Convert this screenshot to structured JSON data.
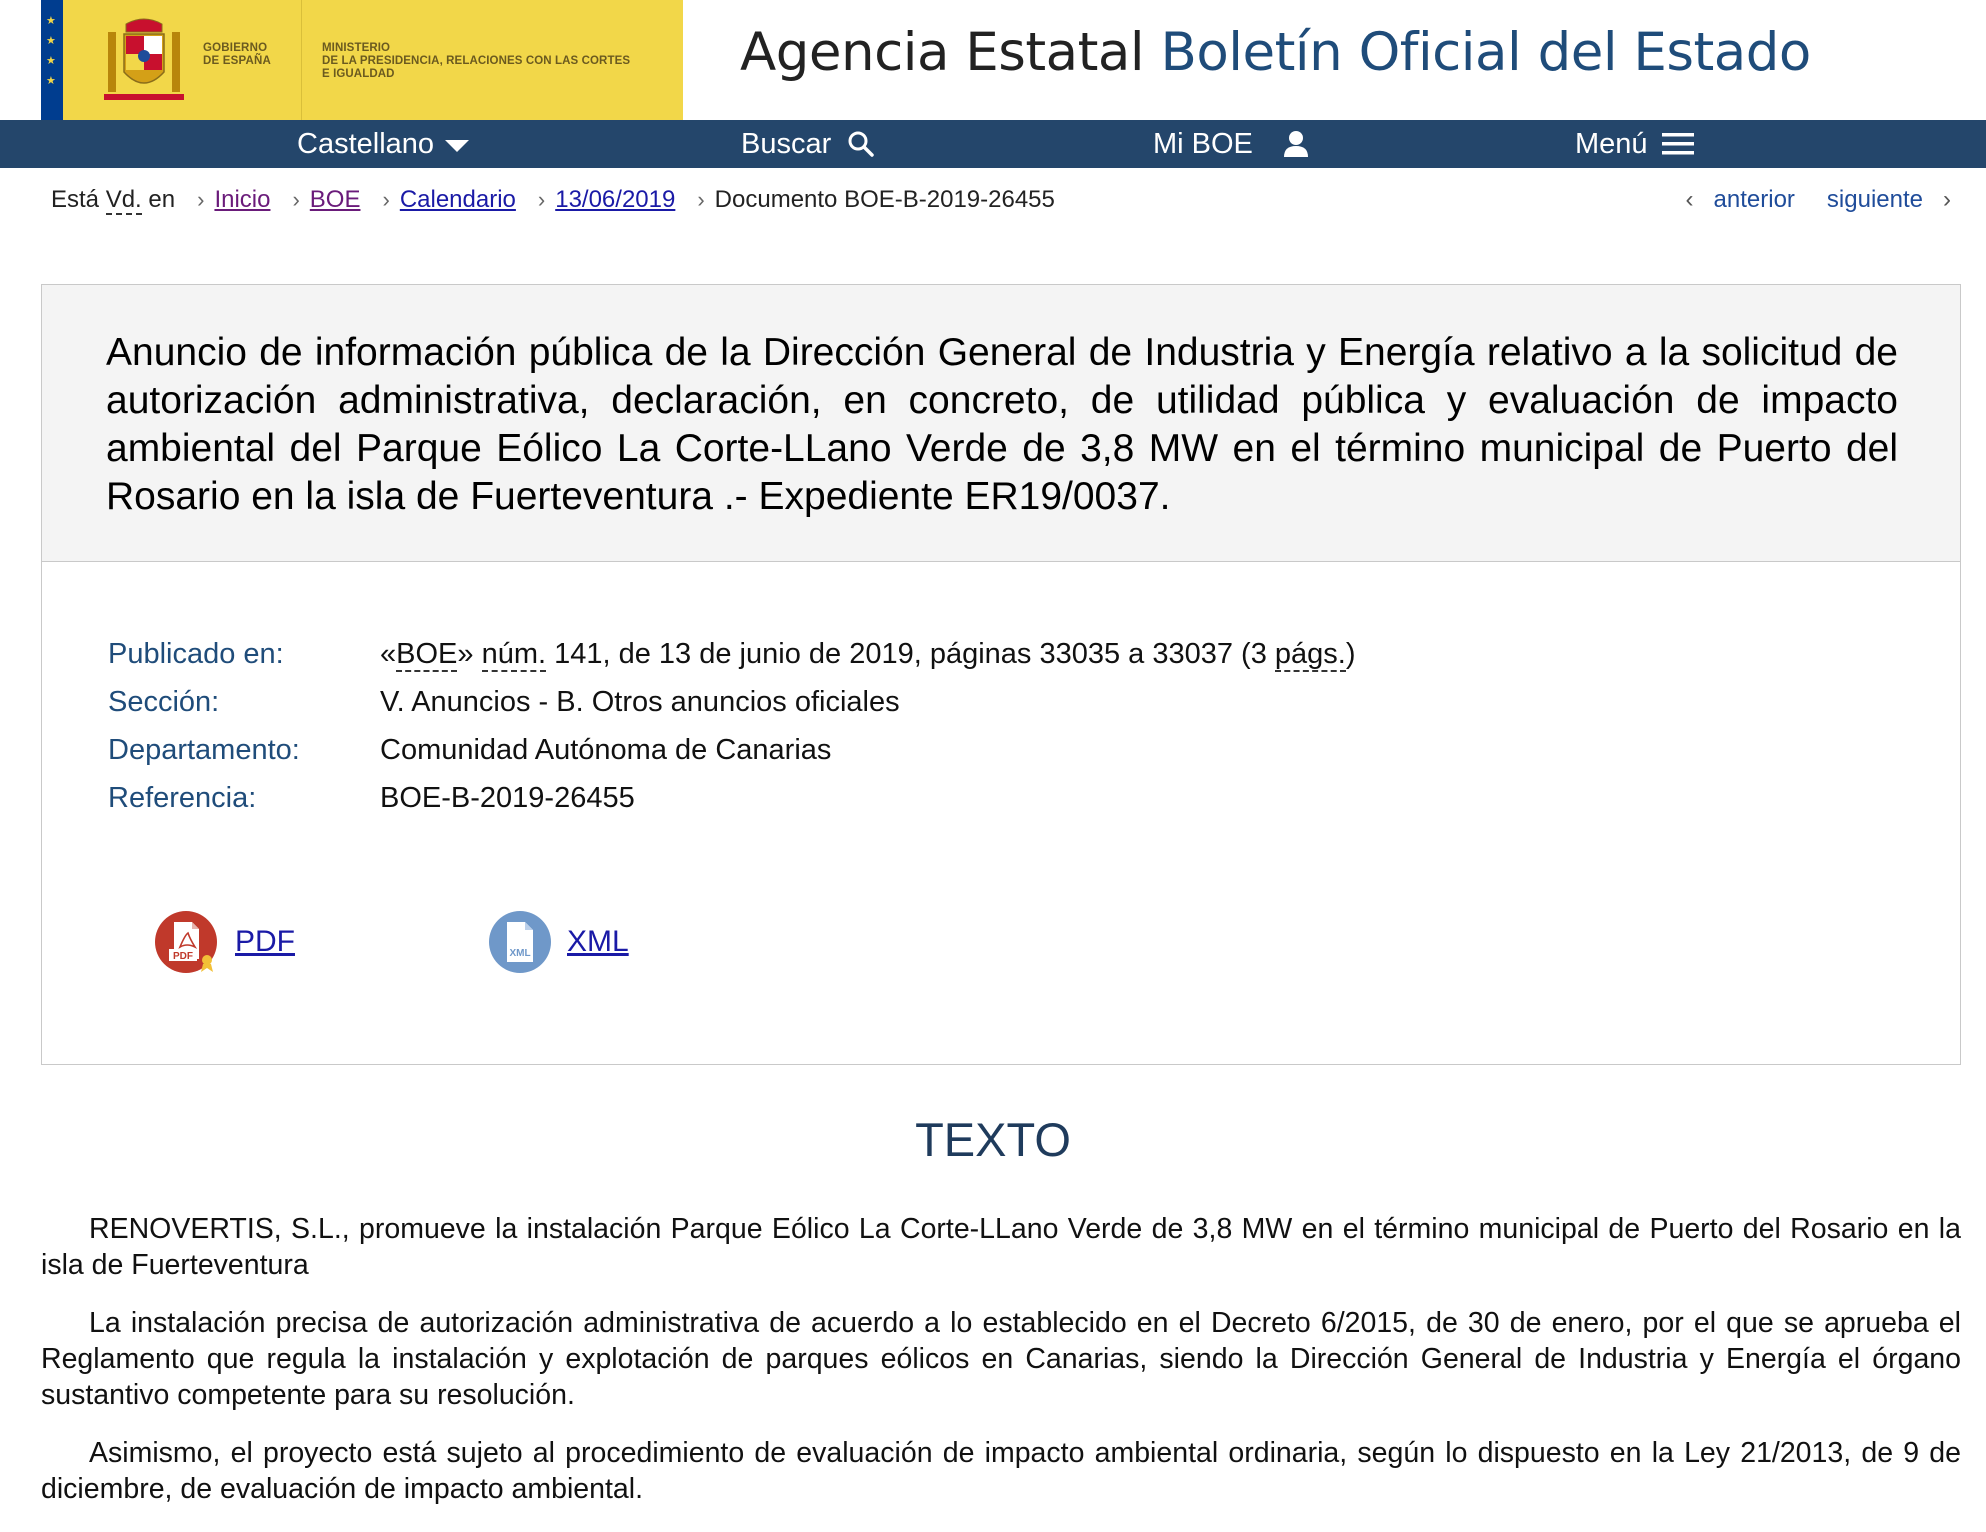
{
  "header": {
    "gov_label_line1": "Gobierno",
    "gov_label_line2": "de España",
    "ministry_line1": "Ministerio",
    "ministry_line2": "de la Presidencia, Relaciones con las Cortes",
    "ministry_line3": "e Igualdad",
    "site_title_prefix": "Agencia Estatal",
    "site_title_accent": "Boletín Oficial del Estado"
  },
  "nav": {
    "language": "Castellano",
    "search": "Buscar",
    "my_boe": "Mi BOE",
    "menu": "Menú"
  },
  "breadcrumb": {
    "lead_pre": "Está ",
    "lead_abbr": "Vd.",
    "lead_post": " en",
    "items": [
      "Inicio",
      "BOE",
      "Calendario",
      "13/06/2019"
    ],
    "current": "Documento BOE-B-2019-26455"
  },
  "pager": {
    "previous": "anterior",
    "next": "siguiente"
  },
  "document": {
    "title": "Anuncio de información pública de la Dirección General de Industria y Energía relativo a la solicitud de autorización administrativa, declaración, en concreto, de utilidad pública y evaluación de impacto ambiental del Parque Eólico La Corte-LLano Verde de 3,8 MW en el término municipal de Puerto del Rosario en la isla de Fuerteventura .- Expediente ER19/0037.",
    "meta": {
      "published_label": "Publicado en:",
      "published_q_open": "«",
      "published_boe": "BOE",
      "published_q_close": "» ",
      "published_num": "núm.",
      "published_rest": " 141, de 13 de junio de 2019, páginas 33035 a 33037 (3 ",
      "published_pags": "págs.",
      "published_end": ")",
      "section_label": "Sección:",
      "section_value": "V. Anuncios - B. Otros anuncios oficiales",
      "department_label": "Departamento:",
      "department_value": "Comunidad Autónoma de Canarias",
      "reference_label": "Referencia:",
      "reference_value": "BOE-B-2019-26455"
    },
    "downloads": {
      "pdf_label": "PDF",
      "pdf_icon_text": "PDF",
      "xml_label": "XML",
      "xml_icon_text": "XML"
    }
  },
  "body": {
    "section_title": "TEXTO",
    "paragraphs": [
      "RENOVERTIS, S.L., promueve la instalación Parque Eólico La Corte-LLano Verde de 3,8 MW en el término municipal de Puerto del Rosario en la isla de Fuerteventura",
      "La instalación precisa de autorización administrativa de acuerdo a lo establecido en el Decreto 6/2015, de 30 de enero, por el que se aprueba el Reglamento que regula la instalación y explotación de parques eólicos en Canarias, siendo la Dirección General de Industria y Energía el órgano sustantivo competente para su resolución.",
      "Asimismo, el proyecto está sujeto al procedimiento de evaluación de impacto ambiental ordinaria, según lo dispuesto en la Ley 21/2013, de 9 de diciembre, de evaluación de impacto ambiental."
    ]
  },
  "colors": {
    "navbar": "#24466b",
    "gov_yellow": "#f2d749",
    "accent_blue": "#1f4c7a",
    "link": "#1a1aa6",
    "pdf_red": "#c0392b",
    "xml_blue": "#6f98c9"
  }
}
